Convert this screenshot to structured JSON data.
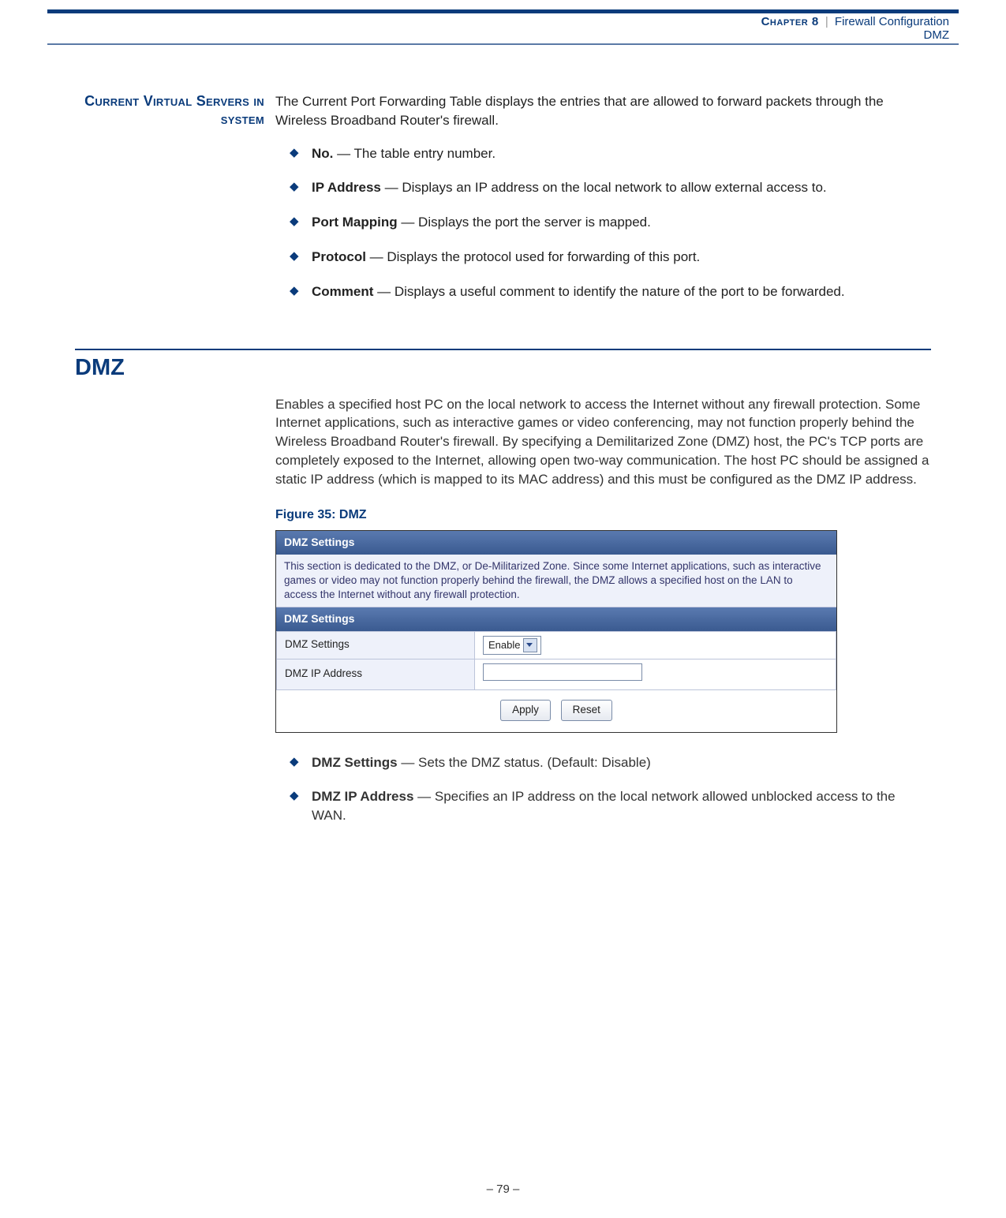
{
  "header": {
    "chapter_label": "Chapter 8",
    "chapter_title": "Firewall Configuration",
    "subtitle": "DMZ"
  },
  "section1": {
    "side_heading": "Current Virtual Servers in system",
    "intro": "The Current Port Forwarding Table displays the entries that are allowed to forward packets through the Wireless Broadband Router's firewall.",
    "bullets": [
      {
        "term": "No.",
        "desc": " — The table entry number."
      },
      {
        "term": "IP Address",
        "desc": " — Displays an IP address on the local network to allow external access to."
      },
      {
        "term": "Port Mapping",
        "desc": " — Displays the port the server is mapped."
      },
      {
        "term": "Protocol",
        "desc": " — Displays the protocol used for forwarding of this port."
      },
      {
        "term": "Comment",
        "desc": " — Displays a useful comment to identify the nature of the port to be forwarded."
      }
    ]
  },
  "section2": {
    "title": "DMZ",
    "intro": "Enables a specified host PC on the local network to access the Internet without any firewall protection. Some Internet applications, such as interactive games or video conferencing, may not function properly behind the Wireless Broadband Router's firewall. By specifying a Demilitarized Zone (DMZ) host, the PC's TCP ports are completely exposed to the Internet, allowing open two-way communication. The host PC should be assigned a static IP address (which is mapped to its MAC address) and this must be configured as the DMZ IP address.",
    "fig_caption": "Figure 35:  DMZ",
    "figure": {
      "bar1": "DMZ Settings",
      "desc": "This section is dedicated to the DMZ, or De-Militarized Zone. Since some Internet applications, such as interactive games or video may not function properly behind the firewall, the DMZ allows a specified host on the LAN to access the Internet without any firewall protection.",
      "bar2": "DMZ Settings",
      "row1_label": "DMZ Settings",
      "row1_value": "Enable",
      "row2_label": "DMZ IP Address",
      "btn_apply": "Apply",
      "btn_reset": "Reset"
    },
    "bullets": [
      {
        "term": "DMZ Settings",
        "desc": " — Sets the DMZ status. (Default: Disable)"
      },
      {
        "term": "DMZ IP Address",
        "desc": " — Specifies an IP address on the local network allowed unblocked access to the WAN."
      }
    ]
  },
  "footer": {
    "page": "–  79  –"
  }
}
